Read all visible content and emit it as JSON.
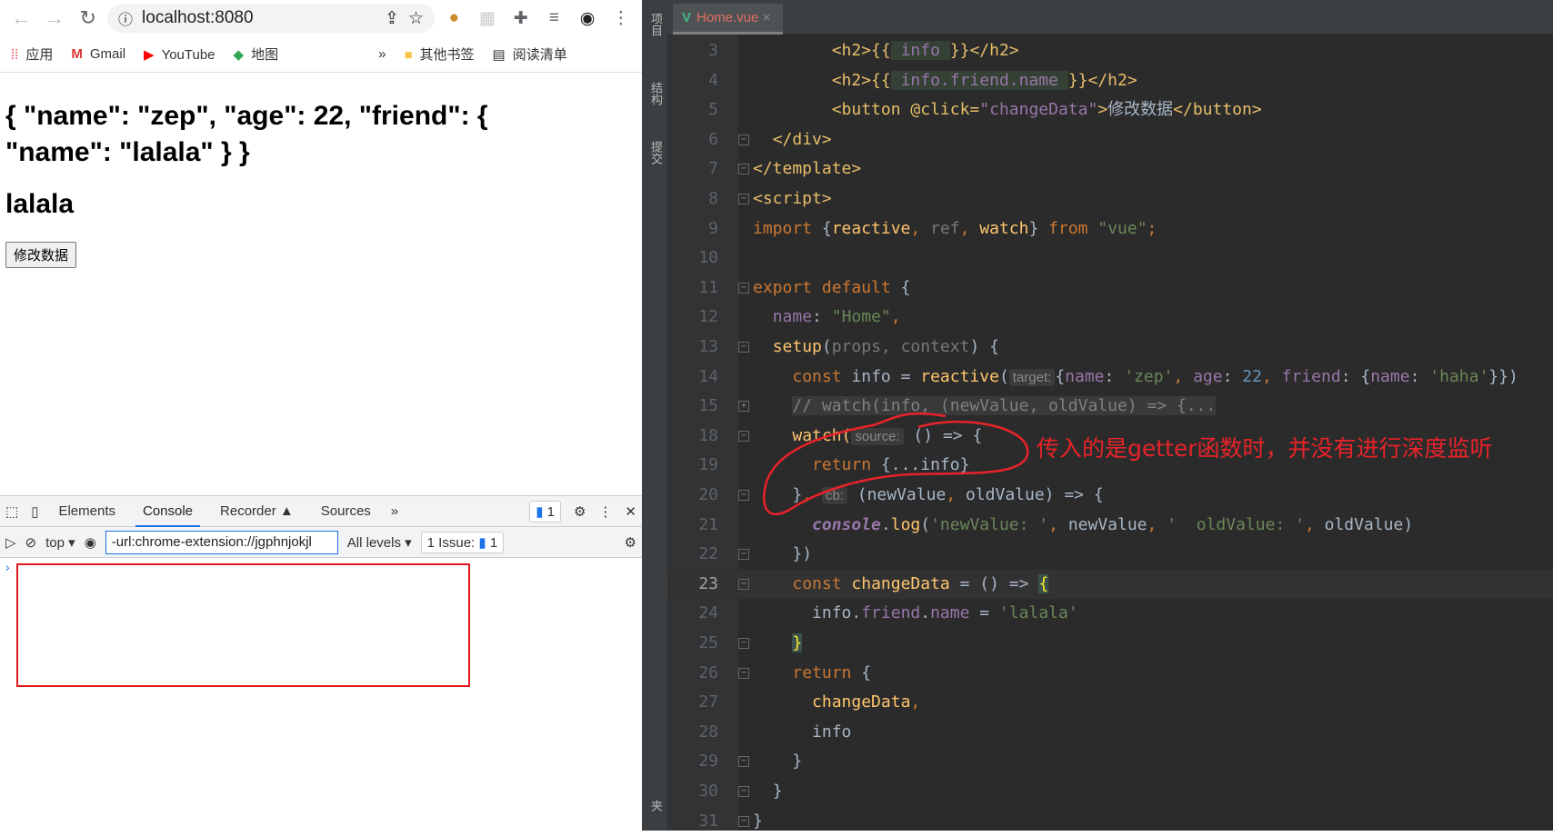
{
  "browser": {
    "url": "localhost:8080",
    "bookmarks": [
      "应用",
      "Gmail",
      "YouTube",
      "地图"
    ],
    "bookmarks_overflow": "»",
    "other_bookmarks": "其他书签",
    "reading_list": "阅读清单",
    "page": {
      "info_json": "{ \"name\": \"zep\", \"age\": 22, \"friend\": { \"name\": \"lalala\" } }",
      "friend_name": "lalala",
      "button": "修改数据"
    }
  },
  "devtools": {
    "tabs": [
      "Elements",
      "Console",
      "Recorder",
      "Sources"
    ],
    "active_tab": "Console",
    "more": "»",
    "messages_badge": "1",
    "context": "top",
    "filter_value": "-url:chrome-extension://jgphnjokjl",
    "levels": "All levels",
    "issues": "1 Issue:",
    "issues_count": "1",
    "prompt": "›"
  },
  "ide": {
    "side_labels": [
      "项目",
      "结构",
      "提交",
      "收藏夹"
    ],
    "file_tab": "Home.vue",
    "current_line": "23",
    "annotation": "传入的是getter函数时，并没有进行深度监听",
    "lines": [
      {
        "n": "3",
        "c": [
          [
            "        "
          ],
          [
            "<h2>{{",
            "tag"
          ],
          [
            " info ",
            "prop hl"
          ],
          [
            "}}</h2>",
            "tag"
          ]
        ]
      },
      {
        "n": "4",
        "c": [
          [
            "        "
          ],
          [
            "<h2>{{",
            "tag"
          ],
          [
            " info.friend.name ",
            "prop hl"
          ],
          [
            "}}</h2>",
            "tag"
          ]
        ]
      },
      {
        "n": "5",
        "c": [
          [
            "        "
          ],
          [
            "<button ",
            "tag"
          ],
          [
            "@click=",
            "tag"
          ],
          [
            "\"changeData\"",
            "prop"
          ],
          [
            ">",
            "tag"
          ],
          [
            "修改数据"
          ],
          [
            "</button>",
            "tag"
          ]
        ]
      },
      {
        "n": "6",
        "c": [
          [
            "  "
          ],
          [
            "</div>",
            "tag"
          ]
        ]
      },
      {
        "n": "7",
        "c": [
          [
            "</template>",
            "tag"
          ]
        ]
      },
      {
        "n": "8",
        "c": [
          [
            "<script>",
            "tag"
          ]
        ]
      },
      {
        "n": "9",
        "c": [
          [
            "import ",
            "kw"
          ],
          [
            "{"
          ],
          [
            "reactive",
            "fn"
          ],
          [
            ", ",
            "kw"
          ],
          [
            "ref",
            "dim"
          ],
          [
            ", ",
            "kw"
          ],
          [
            "watch",
            "fn"
          ],
          [
            "} "
          ],
          [
            "from ",
            "kw"
          ],
          [
            "\"vue\"",
            "str"
          ],
          [
            ";",
            "kw"
          ]
        ]
      },
      {
        "n": "10",
        "c": []
      },
      {
        "n": "11",
        "c": [
          [
            "export default ",
            "kw"
          ],
          [
            "{"
          ]
        ]
      },
      {
        "n": "12",
        "c": [
          [
            "  "
          ],
          [
            "name",
            "prop"
          ],
          [
            ": "
          ],
          [
            "\"Home\"",
            "str"
          ],
          [
            ",",
            "kw"
          ]
        ]
      },
      {
        "n": "13",
        "c": [
          [
            "  "
          ],
          [
            "setup",
            "fn"
          ],
          [
            "("
          ],
          [
            "props, context",
            "dim"
          ],
          [
            ") {"
          ]
        ]
      },
      {
        "n": "14",
        "c": [
          [
            "    "
          ],
          [
            "const ",
            "kw"
          ],
          [
            "info = "
          ],
          [
            "reactive",
            "fn"
          ],
          [
            "("
          ],
          [
            "target:",
            "hint"
          ],
          [
            "{"
          ],
          [
            "name",
            "prop"
          ],
          [
            ": "
          ],
          [
            "'zep'",
            "str"
          ],
          [
            ", ",
            "kw"
          ],
          [
            "age",
            "prop"
          ],
          [
            ": "
          ],
          [
            "22",
            "num"
          ],
          [
            ", ",
            "kw"
          ],
          [
            "friend",
            "prop"
          ],
          [
            ": {"
          ],
          [
            "name",
            "prop"
          ],
          [
            ": "
          ],
          [
            "'haha'",
            "str"
          ],
          [
            "}})"
          ]
        ]
      },
      {
        "n": "15",
        "c": [
          [
            "    "
          ],
          [
            "// watch(info, (newValue, oldValue) => {...",
            "cm fold-bg"
          ]
        ]
      },
      {
        "n": "18",
        "c": [
          [
            "    "
          ],
          [
            "watch(",
            "fn"
          ],
          [
            "source:",
            "hint"
          ],
          [
            " () => {"
          ]
        ]
      },
      {
        "n": "19",
        "c": [
          [
            "      "
          ],
          [
            "return ",
            "kw"
          ],
          [
            "{...info}"
          ]
        ]
      },
      {
        "n": "20",
        "c": [
          [
            "    "
          ],
          [
            "}"
          ],
          [
            ", ",
            "kw"
          ],
          [
            "cb:",
            "hint"
          ],
          [
            " (newValue"
          ],
          [
            ", ",
            "kw"
          ],
          [
            "oldValue) => {"
          ]
        ]
      },
      {
        "n": "21",
        "c": [
          [
            "      "
          ],
          [
            "console",
            "it"
          ],
          [
            "."
          ],
          [
            "log",
            "fn"
          ],
          [
            "("
          ],
          [
            "'newValue: '",
            "str"
          ],
          [
            ", ",
            "kw"
          ],
          [
            "newValue"
          ],
          [
            ", ",
            "kw"
          ],
          [
            "'  oldValue: '",
            "str"
          ],
          [
            ", ",
            "kw"
          ],
          [
            "oldValue)"
          ]
        ]
      },
      {
        "n": "22",
        "c": [
          [
            "    "
          ],
          [
            "})"
          ]
        ]
      },
      {
        "n": "23",
        "c": [
          [
            "    "
          ],
          [
            "const ",
            "kw"
          ],
          [
            "changeData",
            "fn"
          ],
          [
            " = () => "
          ],
          [
            "{",
            "brace"
          ]
        ]
      },
      {
        "n": "24",
        "c": [
          [
            "      "
          ],
          [
            "info."
          ],
          [
            "friend",
            "prop"
          ],
          [
            "."
          ],
          [
            "name",
            "prop"
          ],
          [
            " = "
          ],
          [
            "'lalala'",
            "str"
          ]
        ]
      },
      {
        "n": "25",
        "c": [
          [
            "    "
          ],
          [
            "}",
            "brace"
          ]
        ]
      },
      {
        "n": "26",
        "c": [
          [
            "    "
          ],
          [
            "return ",
            "kw"
          ],
          [
            "{"
          ]
        ]
      },
      {
        "n": "27",
        "c": [
          [
            "      "
          ],
          [
            "changeData",
            "fn"
          ],
          [
            ",",
            "kw"
          ]
        ]
      },
      {
        "n": "28",
        "c": [
          [
            "      "
          ],
          [
            "info"
          ]
        ]
      },
      {
        "n": "29",
        "c": [
          [
            "    "
          ],
          [
            "}"
          ]
        ]
      },
      {
        "n": "30",
        "c": [
          [
            "  "
          ],
          [
            "}"
          ]
        ]
      },
      {
        "n": "31",
        "c": [
          [
            "}"
          ]
        ]
      }
    ],
    "fold_lines": [
      "6",
      "7",
      "8",
      "11",
      "13",
      "15",
      "18",
      "20",
      "22",
      "23",
      "25",
      "26",
      "29",
      "30",
      "31"
    ],
    "colors": {
      "annotation": "#e8232a",
      "vue_green": "#41b883",
      "console_tab_underline": "#1a73e8"
    }
  }
}
